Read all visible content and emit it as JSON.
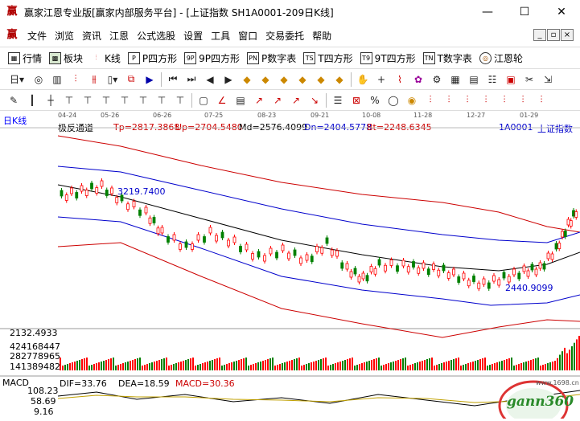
{
  "window": {
    "title": "赢家江恩专业版[赢家内部服务平台] - [上证指数  SH1A0001-209日K线]",
    "minimize": "—",
    "maximize": "☐",
    "close": "✕"
  },
  "menu": {
    "icon": "赢",
    "items": [
      "文件",
      "浏览",
      "资讯",
      "江恩",
      "公式选股",
      "设置",
      "工具",
      "窗口",
      "交易委托",
      "帮助"
    ],
    "mdi": [
      "_",
      "▫",
      "×"
    ]
  },
  "toolbar1": {
    "items": [
      {
        "label": "行情",
        "icon": "grid-icon"
      },
      {
        "label": "板块",
        "icon": "blocks-icon"
      },
      {
        "label": "K线",
        "icon": "candles-icon"
      },
      {
        "label": "P四方形",
        "icon": "P"
      },
      {
        "label": "9P四方形",
        "icon": "9P"
      },
      {
        "label": "P数字表",
        "icon": "PN"
      },
      {
        "label": "T四方形",
        "icon": "TS"
      },
      {
        "label": "9T四方形",
        "icon": "T9"
      },
      {
        "label": "T数字表",
        "icon": "TN"
      },
      {
        "label": "江恩轮",
        "icon": "wheel-icon"
      }
    ]
  },
  "chart": {
    "period_label": "日K线",
    "indicator_name": "极反通道",
    "tp": "Tp=2817.3868",
    "up": "Up=2704.5480",
    "md": "Md=2576.4099",
    "dn": "Dn=2404.5778",
    "bt": "Bt=2248.6345",
    "symbol": "1A0001",
    "symbol_name": "上证指数",
    "high_label": "3219.7400",
    "low_label": "2440.9099",
    "price_axis": "2132.4933",
    "vol_axis": [
      "424168447",
      "282778965",
      "141389482"
    ],
    "macd_name": "MACD",
    "dif": "DIF=33.76",
    "dea": "DEA=18.59",
    "macd": "MACD=30.36",
    "macd_axis": [
      "108.23",
      "58.69",
      "9.16"
    ],
    "dates": [
      "04-24",
      "05-26",
      "06-26",
      "07-25",
      "08-23",
      "09-21",
      "10-08",
      "11-28",
      "12-27",
      "01-29"
    ],
    "colors": {
      "up": "#ff0000",
      "down": "#008000",
      "channel_outer": "#cc0000",
      "channel_inner": "#0000cc",
      "mid": "#000000"
    }
  },
  "watermark": {
    "brand": "gann360",
    "url": "www.1698.cn"
  },
  "chart_data": {
    "type": "line",
    "title": "上证指数",
    "x": [
      "04-24",
      "05-26",
      "06-26",
      "07-25",
      "08-23",
      "09-21",
      "10-08",
      "11-28",
      "12-27",
      "01-29"
    ],
    "series": [
      {
        "name": "上证指数",
        "values": [
          3150,
          3180,
          3030,
          2900,
          2850,
          2840,
          2760,
          2680,
          2560,
          2620
        ]
      }
    ],
    "ylim": [
      2132.4933,
      3300
    ]
  }
}
